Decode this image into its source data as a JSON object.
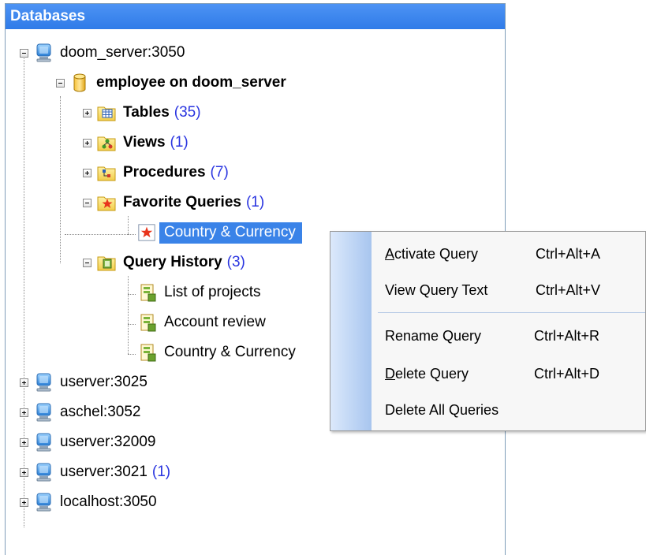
{
  "panel": {
    "title": "Databases"
  },
  "tree": {
    "server1": {
      "label": "doom_server:3050"
    },
    "database": {
      "label": "employee on doom_server"
    },
    "tables": {
      "label": "Tables",
      "count": "(35)"
    },
    "views": {
      "label": "Views",
      "count": "(1)"
    },
    "procedures": {
      "label": "Procedures",
      "count": "(7)"
    },
    "favorites": {
      "label": "Favorite Queries",
      "count": "(1)"
    },
    "favorite_item": {
      "label": "Country & Currency"
    },
    "history": {
      "label": "Query History",
      "count": "(3)"
    },
    "history_items": [
      {
        "label": "List of projects"
      },
      {
        "label": "Account review"
      },
      {
        "label": "Country & Currency"
      }
    ],
    "servers": [
      {
        "label": "userver:3025",
        "count": ""
      },
      {
        "label": "aschel:3052",
        "count": ""
      },
      {
        "label": "userver:32009",
        "count": ""
      },
      {
        "label": "userver:3021",
        "count": "(1)"
      },
      {
        "label": "localhost:3050",
        "count": ""
      }
    ]
  },
  "context_menu": {
    "items": [
      {
        "accel": "A",
        "rest": "ctivate Query",
        "shortcut": "Ctrl+Alt+A"
      },
      {
        "label": "View Query Text",
        "shortcut": "Ctrl+Alt+V"
      },
      {
        "label": "Rename Query",
        "shortcut": "Ctrl+Alt+R"
      },
      {
        "accel": "D",
        "rest": "elete Query",
        "shortcut": "Ctrl+Alt+D"
      },
      {
        "label": "Delete All Queries",
        "shortcut": ""
      }
    ]
  },
  "colors": {
    "header_bg": "#3f88f0",
    "selection_bg": "#3a83e8",
    "count_text": "#2a35e0",
    "menu_strip": "#b7d0f3"
  }
}
